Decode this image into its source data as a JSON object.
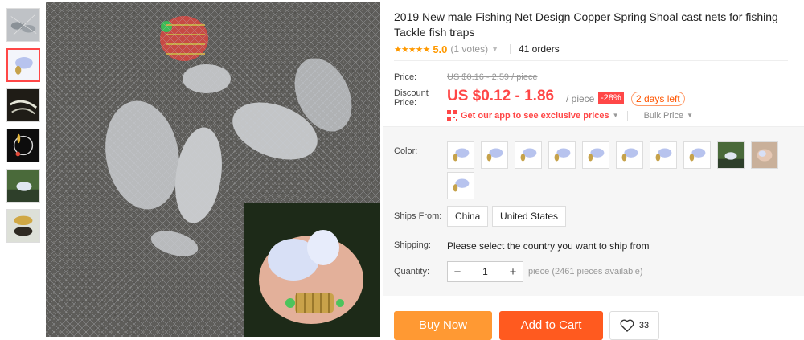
{
  "product": {
    "title": "2019 New male Fishing Net Design Copper Spring Shoal cast nets for fishing Tackle fish traps"
  },
  "rating": {
    "stars": "★★★★★",
    "score": "5.0",
    "votes": "(1 votes)",
    "orders": "41 orders"
  },
  "price": {
    "label": "Price:",
    "original": "US $0.16 - 2.59 / piece",
    "discount_label": "Discount Price:",
    "discount": "US $0.12 - 1.86",
    "per_piece": "/ piece",
    "discount_pct": "-28%",
    "time_left": "2 days left",
    "app_offer": "Get our app to see exclusive prices",
    "bulk_price": "Bulk Price"
  },
  "options": {
    "color_label": "Color:",
    "ships_from_label": "Ships From:",
    "ships_from": [
      "China",
      "United States"
    ],
    "shipping_label": "Shipping:",
    "shipping_text": "Please select the country you want to ship from",
    "quantity_label": "Quantity:",
    "quantity": "1",
    "qty_minus": "−",
    "qty_plus": "+",
    "availability": "piece (2461 pieces available)"
  },
  "actions": {
    "buy_now": "Buy Now",
    "add_to_cart": "Add to Cart",
    "wishlist_count": "33"
  },
  "colors": {
    "accent_red": "#ff4747",
    "buy_orange": "#ff9933",
    "cart_orange": "#ff5a1f",
    "star": "#ff9900"
  }
}
